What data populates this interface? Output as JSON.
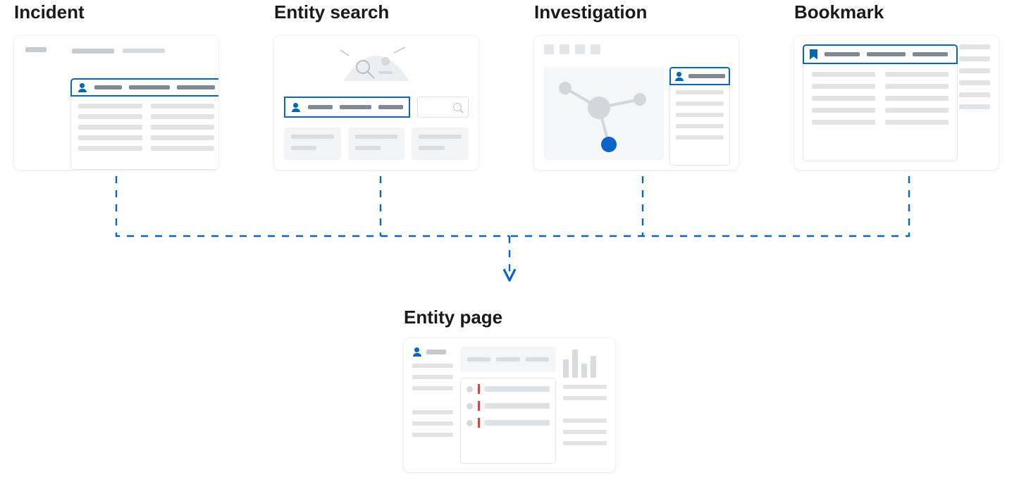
{
  "sources": [
    {
      "id": "incident",
      "label": "Incident"
    },
    {
      "id": "entity-search",
      "label": "Entity search"
    },
    {
      "id": "investigation",
      "label": "Investigation"
    },
    {
      "id": "bookmark",
      "label": "Bookmark"
    }
  ],
  "target": {
    "id": "entity-page",
    "label": "Entity page"
  },
  "colors": {
    "highlight_border": "#0b63c8",
    "connector": "#0b63c8",
    "accent_dot": "#0b63c8",
    "alert_marker": "#c94c4c"
  },
  "diagram": {
    "description": "Four entry points (Incident, Entity search, Investigation, Bookmark) each link via dashed connectors down to a single Entity page."
  }
}
